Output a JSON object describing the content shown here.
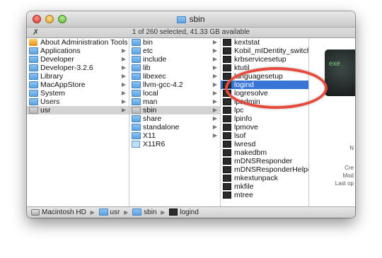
{
  "window": {
    "title": "sbin",
    "status": "1 of 260 selected, 41.33 GB available"
  },
  "columns": [
    {
      "items": [
        {
          "label": "About Administration Tools",
          "icon": "app-icon"
        },
        {
          "label": "Applications",
          "icon": "folder-icon"
        },
        {
          "label": "Developer",
          "icon": "folder-icon"
        },
        {
          "label": "Developer-3.2.6",
          "icon": "folder-icon"
        },
        {
          "label": "Library",
          "icon": "folder-icon"
        },
        {
          "label": "MacAppStore",
          "icon": "folder-icon"
        },
        {
          "label": "System",
          "icon": "folder-icon"
        },
        {
          "label": "Users",
          "icon": "folder-icon"
        },
        {
          "label": "usr",
          "icon": "folder-icon",
          "selected": "inactive"
        }
      ]
    },
    {
      "items": [
        {
          "label": "bin",
          "icon": "folder-icon"
        },
        {
          "label": "etc",
          "icon": "folder-icon"
        },
        {
          "label": "include",
          "icon": "folder-icon"
        },
        {
          "label": "lib",
          "icon": "folder-icon"
        },
        {
          "label": "libexec",
          "icon": "folder-icon"
        },
        {
          "label": "llvm-gcc-4.2",
          "icon": "folder-icon"
        },
        {
          "label": "local",
          "icon": "folder-icon"
        },
        {
          "label": "man",
          "icon": "folder-icon"
        },
        {
          "label": "sbin",
          "icon": "folder-icon",
          "selected": "inactive"
        },
        {
          "label": "share",
          "icon": "folder-icon"
        },
        {
          "label": "standalone",
          "icon": "folder-icon"
        },
        {
          "label": "X11",
          "icon": "folder-icon"
        },
        {
          "label": "X11R6",
          "icon": "alias-folder-icon"
        }
      ]
    },
    {
      "items": [
        {
          "label": "kextstat",
          "icon": "executable-icon"
        },
        {
          "label": "Kobil_mIDentity_switch",
          "icon": "executable-icon"
        },
        {
          "label": "krbservicesetup",
          "icon": "executable-icon"
        },
        {
          "label": "ktutil",
          "icon": "executable-icon"
        },
        {
          "label": "languagesetup",
          "icon": "executable-icon"
        },
        {
          "label": "logind",
          "icon": "executable-icon",
          "selected": "active"
        },
        {
          "label": "logresolve",
          "icon": "executable-icon"
        },
        {
          "label": "lpadmin",
          "icon": "executable-icon"
        },
        {
          "label": "lpc",
          "icon": "executable-icon"
        },
        {
          "label": "lpinfo",
          "icon": "executable-icon"
        },
        {
          "label": "lpmove",
          "icon": "executable-icon"
        },
        {
          "label": "lsof",
          "icon": "executable-icon"
        },
        {
          "label": "lwresd",
          "icon": "executable-icon"
        },
        {
          "label": "makedbm",
          "icon": "executable-icon"
        },
        {
          "label": "mDNSResponder",
          "icon": "executable-icon"
        },
        {
          "label": "mDNSResponderHelper",
          "icon": "executable-icon"
        },
        {
          "label": "mkextunpack",
          "icon": "executable-icon"
        },
        {
          "label": "mkfile",
          "icon": "executable-icon"
        },
        {
          "label": "mtree",
          "icon": "executable-icon"
        }
      ]
    }
  ],
  "preview": {
    "thumb_text": "exe",
    "lines": [
      "N",
      "Cre",
      "Mod",
      "Last op"
    ]
  },
  "path_bar": [
    "Macintosh HD",
    "usr",
    "sbin",
    "logind"
  ],
  "colors": {
    "selection_active": "#3875d7",
    "selection_inactive": "#d4d4d4",
    "annotation_ring": "#e74a3b"
  }
}
